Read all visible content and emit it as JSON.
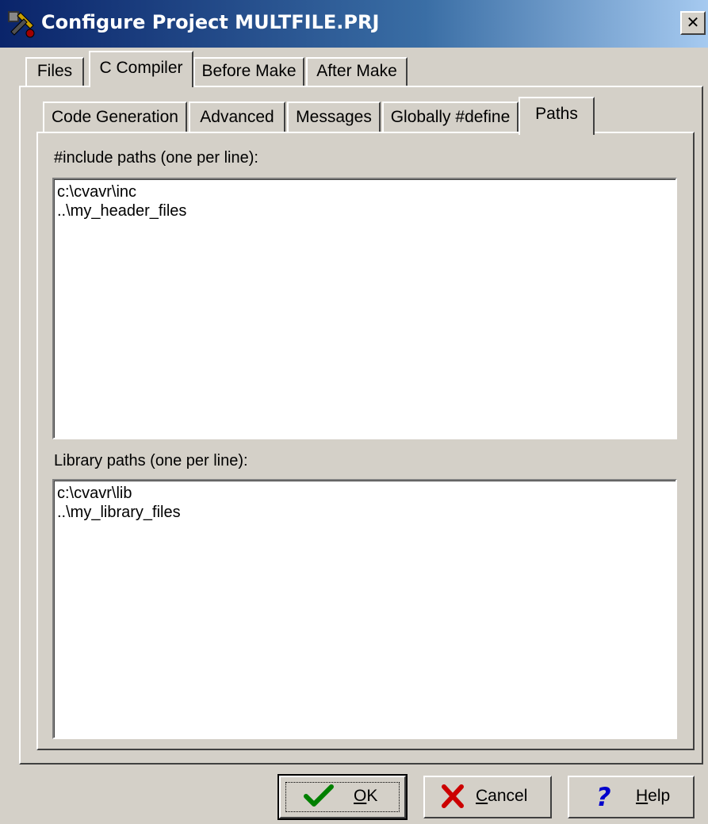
{
  "window": {
    "title": "Configure Project MULTFILE.PRJ",
    "close_glyph": "✕",
    "app_icon": "cvavr-project-icon"
  },
  "outer_tabs": [
    {
      "label": "Files",
      "active": false
    },
    {
      "label": "C Compiler",
      "active": true
    },
    {
      "label": "Before Make",
      "active": false
    },
    {
      "label": "After Make",
      "active": false
    }
  ],
  "inner_tabs": [
    {
      "label": "Code Generation",
      "active": false
    },
    {
      "label": "Advanced",
      "active": false
    },
    {
      "label": "Messages",
      "active": false
    },
    {
      "label": "Globally #define",
      "active": false
    },
    {
      "label": "Paths",
      "active": true
    }
  ],
  "paths": {
    "include_label": "#include paths (one per line):",
    "include_lines": [
      "c:\\cvavr\\inc",
      "..\\my_header_files"
    ],
    "library_label": "Library paths (one per line):",
    "library_lines": [
      "c:\\cvavr\\lib",
      "..\\my_library_files"
    ]
  },
  "buttons": {
    "ok": {
      "label_mnemonic": "O",
      "label_rest": "K",
      "icon": "checkmark-icon",
      "color": "#008000"
    },
    "cancel": {
      "label_mnemonic": "C",
      "label_rest": "ancel",
      "icon": "red-x-icon",
      "color": "#cc0000"
    },
    "help": {
      "label_mnemonic": "H",
      "label_rest": "elp",
      "icon": "question-mark-icon",
      "color": "#0000cc"
    }
  }
}
